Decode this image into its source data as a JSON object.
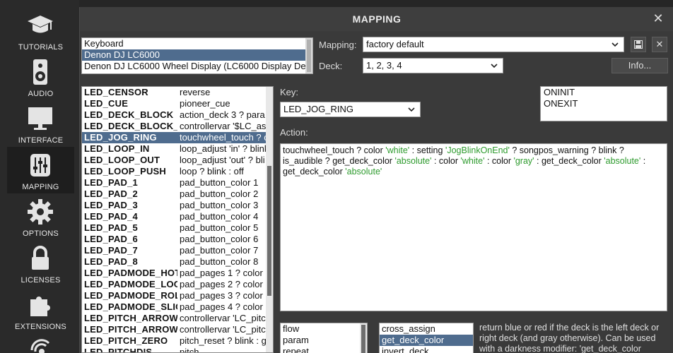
{
  "nav": {
    "items": [
      {
        "label": "TUTORIALS"
      },
      {
        "label": "AUDIO"
      },
      {
        "label": "INTERFACE"
      },
      {
        "label": "MAPPING"
      },
      {
        "label": "OPTIONS"
      },
      {
        "label": "LICENSES"
      },
      {
        "label": "EXTENSIONS"
      }
    ],
    "active": "MAPPING"
  },
  "dialog": {
    "title": "MAPPING",
    "close": "✕"
  },
  "devices": [
    "Keyboard",
    "Denon DJ LC6000",
    "Denon DJ LC6000 Wheel Display (LC6000 Display De"
  ],
  "mapping": {
    "label": "Mapping:",
    "value": "factory default",
    "save_icon": "save-icon",
    "delete": "✕"
  },
  "deck": {
    "label": "Deck:",
    "value": "1, 2, 3, 4"
  },
  "info_button": "Info...",
  "controls": [
    {
      "name": "LED_CENSOR",
      "action": "reverse"
    },
    {
      "name": "LED_CUE",
      "action": "pioneer_cue"
    },
    {
      "name": "LED_DECK_BLOCK",
      "action": "action_deck 3 ? para"
    },
    {
      "name": "LED_DECK_BLOCK_",
      "action": "controllervar '$LC_as"
    },
    {
      "name": "LED_JOG_RING",
      "action": "touchwheel_touch ? c"
    },
    {
      "name": "LED_LOOP_IN",
      "action": "loop_adjust 'in' ? blink"
    },
    {
      "name": "LED_LOOP_OUT",
      "action": "loop_adjust 'out' ? bli"
    },
    {
      "name": "LED_LOOP_PUSH",
      "action": "loop ? blink : off"
    },
    {
      "name": "LED_PAD_1",
      "action": "pad_button_color 1"
    },
    {
      "name": "LED_PAD_2",
      "action": "pad_button_color 2"
    },
    {
      "name": "LED_PAD_3",
      "action": "pad_button_color 3"
    },
    {
      "name": "LED_PAD_4",
      "action": "pad_button_color 4"
    },
    {
      "name": "LED_PAD_5",
      "action": "pad_button_color 5"
    },
    {
      "name": "LED_PAD_6",
      "action": "pad_button_color 6"
    },
    {
      "name": "LED_PAD_7",
      "action": "pad_button_color 7"
    },
    {
      "name": "LED_PAD_8",
      "action": "pad_button_color 8"
    },
    {
      "name": "LED_PADMODE_HOT",
      "action": "pad_pages 1 ? color"
    },
    {
      "name": "LED_PADMODE_LOO",
      "action": "pad_pages 2 ? color"
    },
    {
      "name": "LED_PADMODE_ROL",
      "action": "pad_pages 3 ? color"
    },
    {
      "name": "LED_PADMODE_SLIC",
      "action": "pad_pages 4 ? color"
    },
    {
      "name": "LED_PITCH_ARROW",
      "action": "controllervar 'LC_pitc"
    },
    {
      "name": "LED_PITCH_ARROW",
      "action": "controllervar 'LC_pitc"
    },
    {
      "name": "LED_PITCH_ZERO",
      "action": "pitch_reset ? blink : g"
    },
    {
      "name": "LED_PITCHDIS",
      "action": "pitch"
    }
  ],
  "key": {
    "label": "Key:",
    "value": "LED_JOG_RING"
  },
  "events": [
    "ONINIT",
    "ONEXIT"
  ],
  "action": {
    "label": "Action:",
    "tokens": [
      {
        "t": "touchwheel_touch ? color ",
        "s": false
      },
      {
        "t": "'white'",
        "s": true
      },
      {
        "t": " : setting ",
        "s": false
      },
      {
        "t": "'JogBlinkOnEnd'",
        "s": true
      },
      {
        "t": " ? songpos_warning ? blink ? is_audible ? get_deck_color ",
        "s": false
      },
      {
        "t": "'absolute'",
        "s": true
      },
      {
        "t": " : color ",
        "s": false
      },
      {
        "t": "'white'",
        "s": true
      },
      {
        "t": " : color ",
        "s": false
      },
      {
        "t": "'gray'",
        "s": true
      },
      {
        "t": " : get_deck_color ",
        "s": false
      },
      {
        "t": "'absolute'",
        "s": true
      },
      {
        "t": " : get_deck_color ",
        "s": false
      },
      {
        "t": "'absolute'",
        "s": true
      }
    ]
  },
  "categories": [
    "flow",
    "param",
    "repeat"
  ],
  "verbs": [
    "cross_assign",
    "get_deck_color",
    "invert_deck"
  ],
  "help": "return blue or red if the deck is the left deck or right deck (and gray otherwise). Can be used with a darkness modifier: 'get_deck_color"
}
